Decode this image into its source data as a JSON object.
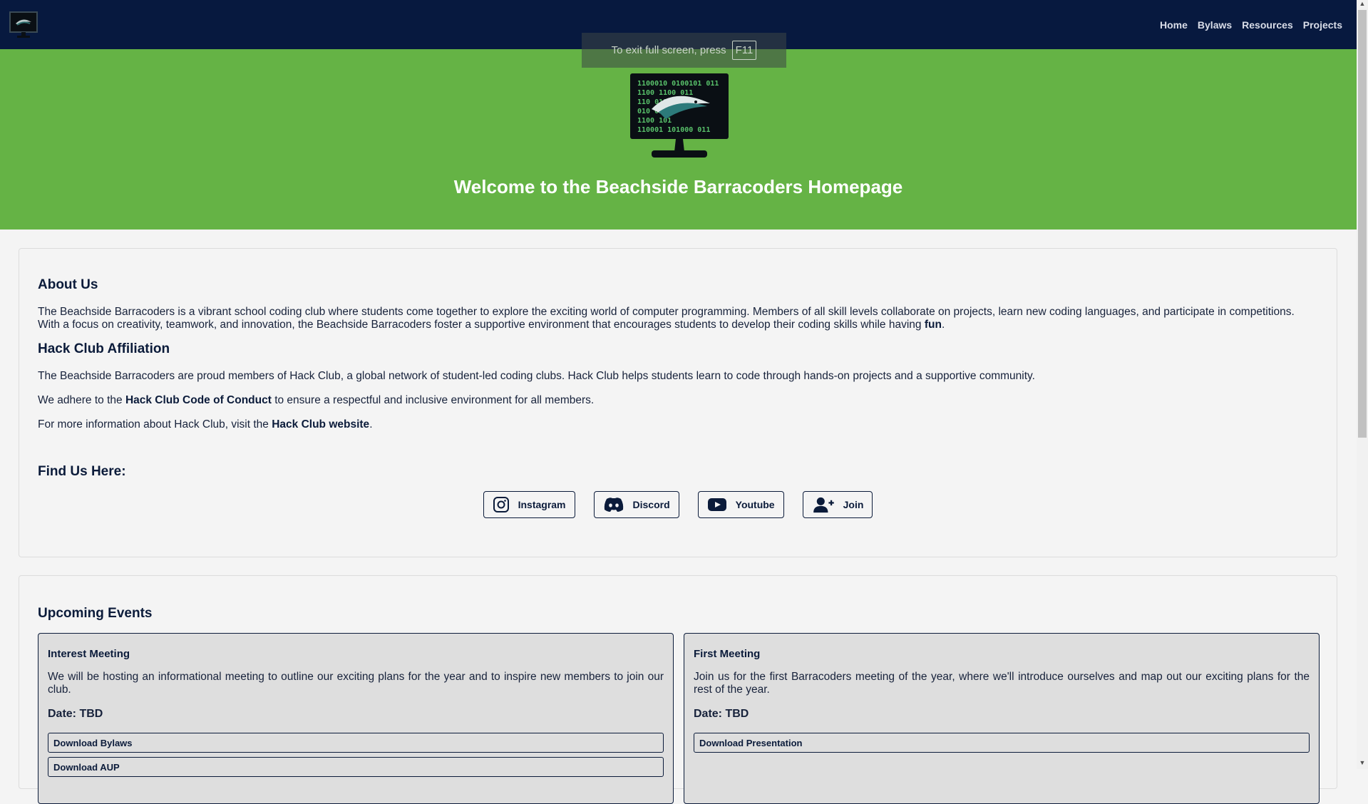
{
  "nav": {
    "items": [
      "Home",
      "Bylaws",
      "Resources",
      "Projects"
    ]
  },
  "fullscreen_notice": {
    "text": "To exit full screen, press",
    "key": "F11"
  },
  "hero": {
    "title": "Welcome to the Beachside Barracoders Homepage",
    "logo_binary": [
      "1100010 0100101 011",
      "1100 1100 011",
      "110 011",
      "010 011",
      "1100 101",
      "110001 101000 011"
    ]
  },
  "about": {
    "heading": "About Us",
    "text": "The Beachside Barracoders is a vibrant school coding club where students come together to explore the exciting world of computer programming. Members of all skill levels collaborate on projects, learn new coding languages, and participate in competitions. With a focus on creativity, teamwork, and innovation, the Beachside Barracoders foster a supportive environment that encourages students to develop their coding skills while having ",
    "text_bold": "fun",
    "text_end": "."
  },
  "affiliation": {
    "heading": "Hack Club Affiliation",
    "p1": "The Beachside Barracoders are proud members of Hack Club, a global network of student-led coding clubs. Hack Club helps students learn to code through hands-on projects and a supportive community.",
    "p2_pre": "We adhere to the ",
    "p2_link": "Hack Club Code of Conduct",
    "p2_post": " to ensure a respectful and inclusive environment for all members.",
    "p3_pre": "For more information about Hack Club, visit the ",
    "p3_link": "Hack Club website",
    "p3_post": "."
  },
  "find_us": {
    "heading": "Find Us Here:",
    "buttons": [
      "Instagram",
      "Discord",
      "Youtube",
      "Join"
    ]
  },
  "events": {
    "heading": "Upcoming Events",
    "items": [
      {
        "title": "Interest Meeting",
        "desc": "We will be hosting an informational meeting to outline our exciting plans for the year and to inspire new members to join our club.",
        "date": "Date: TBD",
        "buttons": [
          "Download Bylaws",
          "Download AUP"
        ]
      },
      {
        "title": "First Meeting",
        "desc": "Join us for the first Barracoders meeting of the year, where we'll introduce ourselves and map out our exciting plans for the rest of the year.",
        "date": "Date: TBD",
        "buttons": [
          "Download Presentation"
        ]
      }
    ]
  },
  "colors": {
    "topbar": "#07193f",
    "hero": "#65b345",
    "text": "#0b1b3a"
  }
}
